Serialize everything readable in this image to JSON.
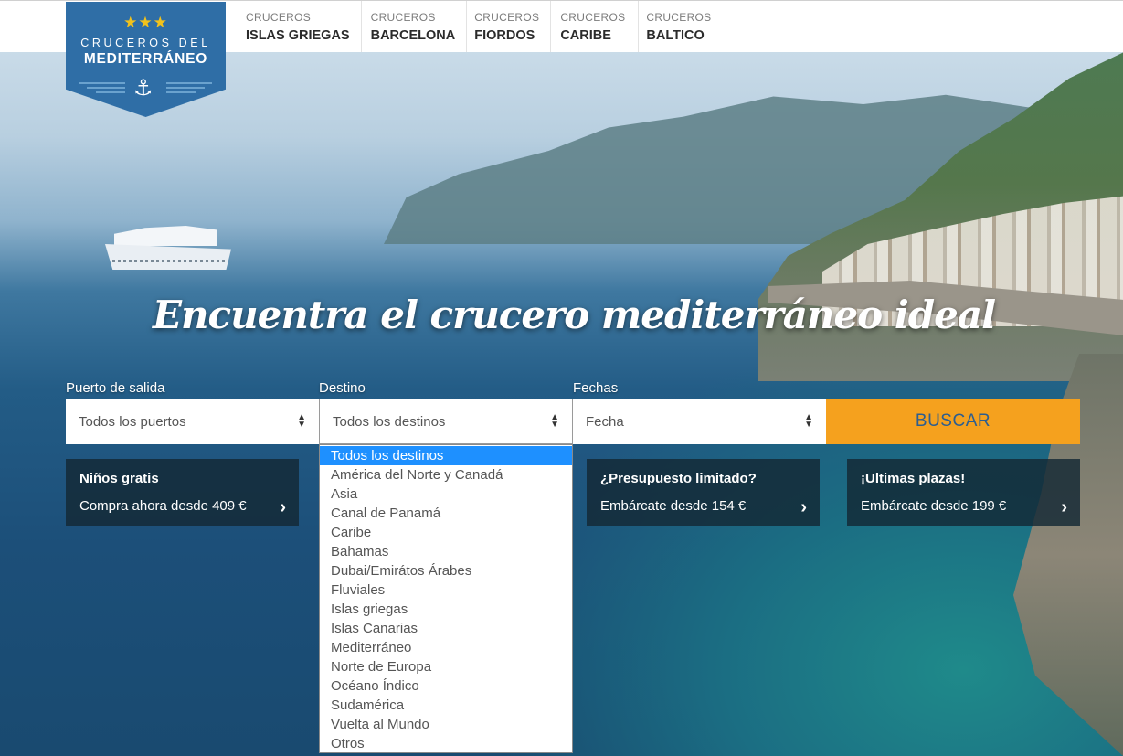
{
  "logo": {
    "stars": "★★★",
    "line1": "CRUCEROS DEL",
    "line2": "MEDITERRÁNEO",
    "anchor_icon": "⚓"
  },
  "nav": [
    {
      "kicker": "CRUCEROS",
      "label": "ISLAS GRIEGAS"
    },
    {
      "kicker": "CRUCEROS",
      "label": "BARCELONA"
    },
    {
      "kicker": "CRUCEROS",
      "label": "FIORDOS"
    },
    {
      "kicker": "CRUCEROS",
      "label": "CARIBE"
    },
    {
      "kicker": "CRUCEROS",
      "label": "BALTICO"
    }
  ],
  "headline": "Encuentra el crucero mediterráneo ideal",
  "search": {
    "port_label": "Puerto de salida",
    "port_value": "Todos los puertos",
    "dest_label": "Destino",
    "dest_value": "Todos los destinos",
    "date_label": "Fechas",
    "date_value": "Fecha",
    "button": "BUSCAR"
  },
  "promos": [
    {
      "title": "Niños gratis",
      "text": "Compra ahora desde 409 €"
    },
    {
      "title": "¿Presupuesto limitado?",
      "text": "Embárcate desde 154 €"
    },
    {
      "title": "¡Ultimas plazas!",
      "text": "Embárcate desde 199 €"
    }
  ],
  "destinations": [
    "Todos los destinos",
    "América del Norte y Canadá",
    "Asia",
    "Canal de Panamá",
    "Caribe",
    "Bahamas",
    "Dubai/Emirátos Árabes",
    "Fluviales",
    "Islas griegas",
    "Islas Canarias",
    "Mediterráneo",
    "Norte de Europa",
    "Océano Índico",
    "Sudamérica",
    "Vuelta al Mundo",
    "Otros"
  ],
  "colors": {
    "accent": "#f5a11e",
    "logo_blue": "#2f6ea6",
    "button_text": "#2d5e8f",
    "selected_option": "#1e90ff"
  }
}
